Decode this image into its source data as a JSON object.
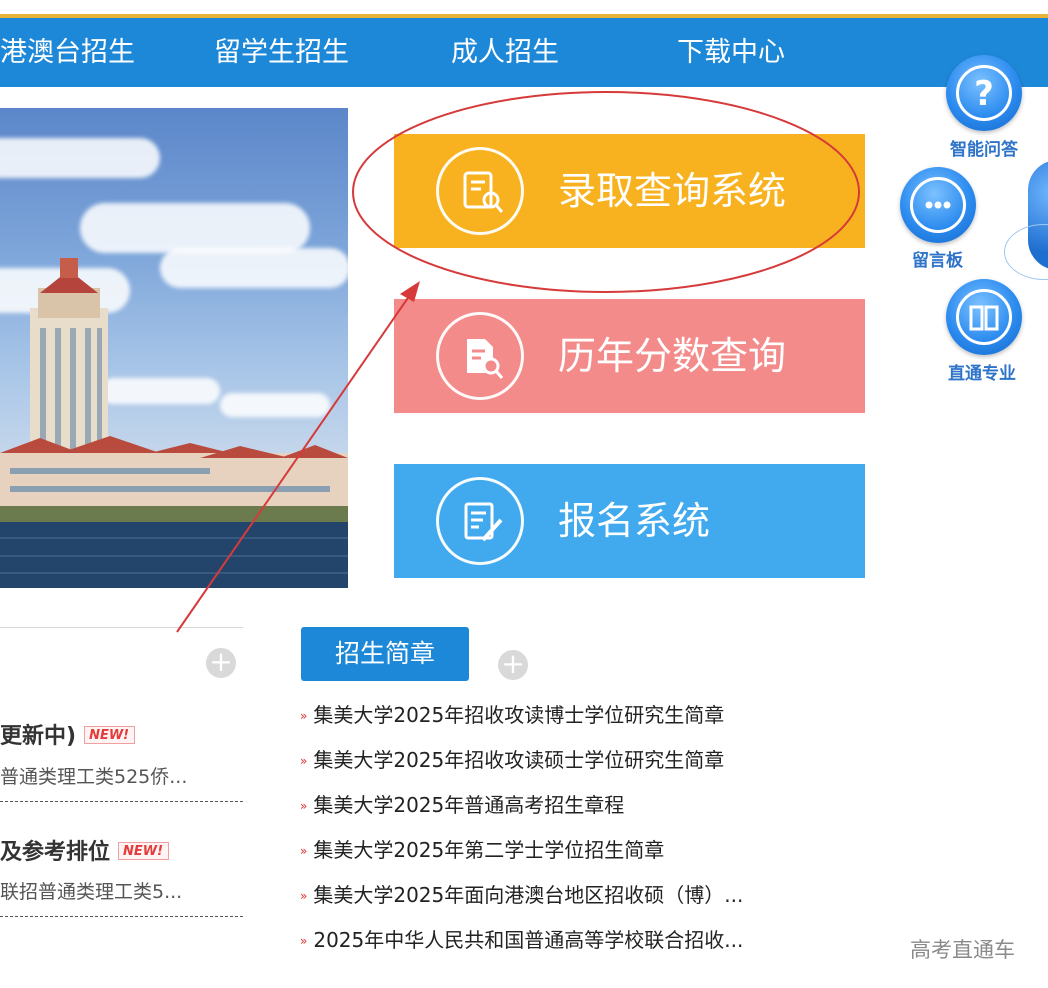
{
  "nav": {
    "items": [
      "港澳台招生",
      "留学生招生",
      "成人招生",
      "下载中心"
    ]
  },
  "systems": [
    {
      "label": "录取查询系统",
      "icon": "document-search-icon",
      "color": "#f8b21f"
    },
    {
      "label": "历年分数查询",
      "icon": "score-report-icon",
      "color": "#f48b8b"
    },
    {
      "label": "报名系统",
      "icon": "sign-up-form-icon",
      "color": "#41a9ee"
    }
  ],
  "side_tools": [
    {
      "label": "智能问答",
      "icon": "question-mark-icon"
    },
    {
      "label": "留言板",
      "icon": "message-dots-icon"
    },
    {
      "label": "直通专业",
      "icon": "open-book-icon"
    }
  ],
  "left_news": [
    {
      "title": "更新中)",
      "sub": "普通类理工类525侨...",
      "badge": "NEW!"
    },
    {
      "title": "及参考排位",
      "sub": "联招普通类理工类5...",
      "badge": "NEW!"
    }
  ],
  "brochure": {
    "tab_label": "招生简章",
    "plus_label": "+",
    "items": [
      "集美大学2025年招收攻读博士学位研究生简章",
      "集美大学2025年招收攻读硕士学位研究生简章",
      "集美大学2025年普通高考招生章程",
      "集美大学2025年第二学士学位招生简章",
      "集美大学2025年面向港澳台地区招收硕（博）...",
      "2025年中华人民共和国普通高等学校联合招收..."
    ]
  },
  "left_plus_label": "+",
  "bullet": "»",
  "watermark": "高考直通车",
  "colors": {
    "nav_bg": "#1e88d8",
    "accent_gold": "#e8b33a",
    "annotation_red": "#d63a3a"
  }
}
